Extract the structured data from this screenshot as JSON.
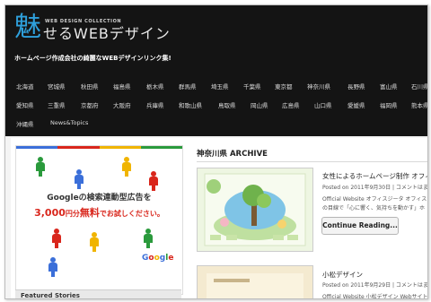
{
  "header": {
    "logo_kanji": "魅",
    "logo_text": "せるWEBデザイン",
    "logo_small": "WEB DESIGN COLLECTION",
    "tagline": "ホームページ作成会社の綺麗なWEBデザインリンク集!"
  },
  "nav": {
    "row1": [
      "北海道",
      "宮城県",
      "秋田県",
      "福島県",
      "栃木県",
      "群馬県",
      "埼玉県",
      "千葉県",
      "東京都",
      "神奈川県",
      "長野県",
      "富山県",
      "石川県"
    ],
    "row2": [
      "愛知県",
      "三重県",
      "京都府",
      "大阪府",
      "兵庫県",
      "和歌山県",
      "鳥取県",
      "岡山県",
      "広島県",
      "山口県",
      "愛媛県",
      "福岡県",
      "熊本県"
    ],
    "row3": [
      "沖縄県",
      "News&Topics"
    ]
  },
  "ad": {
    "line1": "Googleの検索連動型広告を",
    "line2_amount": "3,000",
    "line2_unit": "円分",
    "line2_free": "無料",
    "line2_rest": "でお試しください。",
    "logo": [
      "G",
      "o",
      "o",
      "g",
      "l",
      "e"
    ]
  },
  "featured": {
    "label": "Featured Stories"
  },
  "archive": {
    "title": "神奈川県 ARCHIVE",
    "posts": [
      {
        "title": "女性によるホームページ制作 オフィス",
        "meta": "Posted on 2011年9月30日 | コメントはま",
        "excerpt": "Official Website オフィスジータ オフィスジ",
        "excerpt2": "の目線で「心に響く、気持ちを動かす」ホ"
      },
      {
        "title": "小松デザイン",
        "meta": "Posted on 2011年9月29日 | コメントはま",
        "excerpt": "Official Website 小松デザイン Webサイト"
      }
    ],
    "button": "Continue Reading..."
  },
  "colors": {
    "header_bg": "#141414",
    "logo_accent": "#2fa1dd",
    "ad_red": "#d9261c"
  }
}
